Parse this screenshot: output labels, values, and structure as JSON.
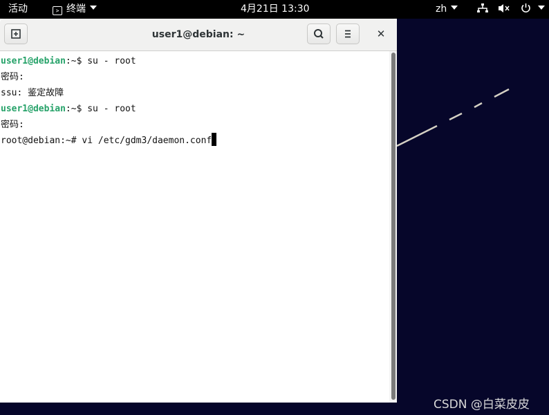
{
  "topbar": {
    "activities": "活动",
    "app_name": "终端",
    "clock": "4月21日 13:30",
    "language": "zh",
    "tray": {
      "network_icon": "network-icon",
      "volume_icon": "volume-muted-icon",
      "power_icon": "power-icon"
    }
  },
  "window": {
    "title": "user1@debian: ~",
    "new_tab_icon": "new-tab-icon",
    "search_icon": "search-icon",
    "menu_icon": "hamburger-menu-icon",
    "close_label": "✕"
  },
  "terminal": {
    "lines": [
      {
        "user": "user1@debian",
        "rest": ":~$ su - root"
      },
      {
        "text": "密码:"
      },
      {
        "text": "ssu: 鉴定故障"
      },
      {
        "user": "user1@debian",
        "rest": ":~$ su - root"
      },
      {
        "text": "密码:"
      },
      {
        "text": "root@debian:~# vi /etc/gdm3/daemon.conf"
      }
    ]
  },
  "watermark": "CSDN @白菜皮皮",
  "colors": {
    "desktop_bg": "#06062a",
    "prompt_green": "#26a269",
    "topbar_bg": "#000000"
  }
}
